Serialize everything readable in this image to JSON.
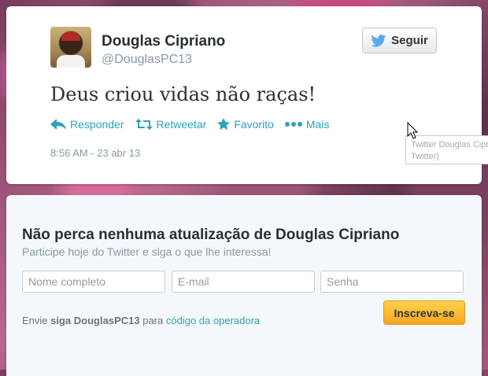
{
  "tweet": {
    "author_name": "Douglas Cipriano",
    "author_handle": "@DouglasPC13",
    "follow_label": "Seguir",
    "text": "Deus criou vidas não raças!",
    "actions": {
      "reply": "Responder",
      "retweet": "Retweetar",
      "favorite": "Favorito",
      "more": "Mais"
    },
    "timestamp": "8:56 AM - 23 abr 13",
    "tooltip_line1": "Twitter Douglas Cipriano",
    "tooltip_line2": "Twitter)"
  },
  "signup": {
    "title": "Não perca nenhuma atualização de Douglas Cipriano",
    "subtitle": "Participe hoje do Twitter e siga o que lhe interessa!",
    "name_placeholder": "Nome completo",
    "email_placeholder": "E-mail",
    "password_placeholder": "Senha",
    "submit_label": "Inscreva-se",
    "sms_prefix": "Envie",
    "sms_command": "siga DouglasPC13",
    "sms_middle": "para",
    "sms_link": "código da operadora"
  },
  "icons": {
    "follow": "twitter-bird-icon",
    "reply": "reply-arrow-icon",
    "retweet": "retweet-icon",
    "favorite": "star-icon",
    "more": "more-dots-icon"
  },
  "colors": {
    "link": "#2aa3b8",
    "twitter_blue": "#55acee",
    "signup_button": "#f5a51f"
  }
}
